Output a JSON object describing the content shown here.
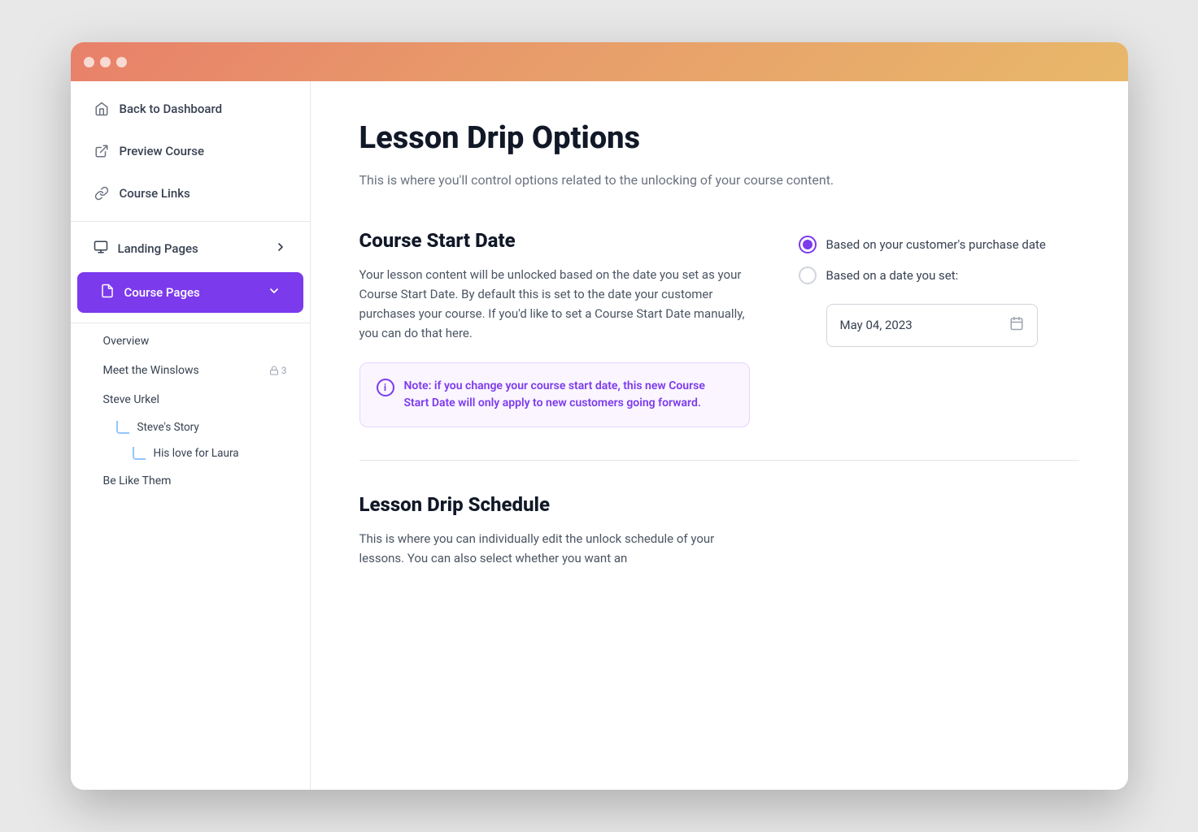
{
  "window": {
    "title": "Lesson Drip Options"
  },
  "titlebar": {
    "traffic_lights": [
      "close",
      "minimize",
      "maximize"
    ]
  },
  "sidebar": {
    "top_nav": [
      {
        "id": "back-dashboard",
        "label": "Back to Dashboard",
        "icon": "home"
      },
      {
        "id": "preview-course",
        "label": "Preview Course",
        "icon": "external-link"
      },
      {
        "id": "course-links",
        "label": "Course Links",
        "icon": "link"
      }
    ],
    "middle_nav": [
      {
        "id": "landing-pages",
        "label": "Landing Pages",
        "icon": "monitor",
        "has_chevron": true,
        "active": false
      }
    ],
    "course_pages": {
      "label": "Course Pages",
      "icon": "file",
      "active": true,
      "items": [
        {
          "id": "overview",
          "label": "Overview",
          "lock": null,
          "indent": 1
        },
        {
          "id": "meet-winslows",
          "label": "Meet the Winslows",
          "lock": 3,
          "indent": 1
        },
        {
          "id": "steve-urkel",
          "label": "Steve Urkel",
          "lock": null,
          "indent": 1
        },
        {
          "id": "steves-story",
          "label": "Steve's Story",
          "lock": null,
          "indent": 2,
          "sub": true
        },
        {
          "id": "his-love-laura",
          "label": "His love for Laura",
          "lock": null,
          "indent": 3,
          "sub": true
        },
        {
          "id": "be-like-them",
          "label": "Be Like Them",
          "lock": null,
          "indent": 1
        }
      ]
    }
  },
  "main": {
    "page_title": "Lesson Drip Options",
    "page_subtitle": "This is where you'll control options related to the unlocking of your course content.",
    "course_start_date": {
      "section_title": "Course Start Date",
      "description": "Your lesson content will be unlocked based on the date you set as your Course Start Date. By default this is set to the date your customer purchases your course. If you'd like to set a Course Start Date manually, you can do that here.",
      "info_note": "Note: if you change your course start date, this new Course Start Date will only apply to new customers going forward.",
      "radio_options": [
        {
          "id": "purchase-date",
          "label": "Based on your customer's purchase date",
          "selected": true
        },
        {
          "id": "custom-date",
          "label": "Based on a date you set:",
          "selected": false
        }
      ],
      "date_value": "May 04, 2023"
    },
    "lesson_drip_schedule": {
      "section_title": "Lesson Drip Schedule",
      "description": "This is where you can individually edit the unlock schedule of your lessons. You can also select whether you want an"
    }
  },
  "colors": {
    "purple_primary": "#7c3aed",
    "purple_light_bg": "#faf5ff",
    "purple_border": "#e9d5ff"
  }
}
